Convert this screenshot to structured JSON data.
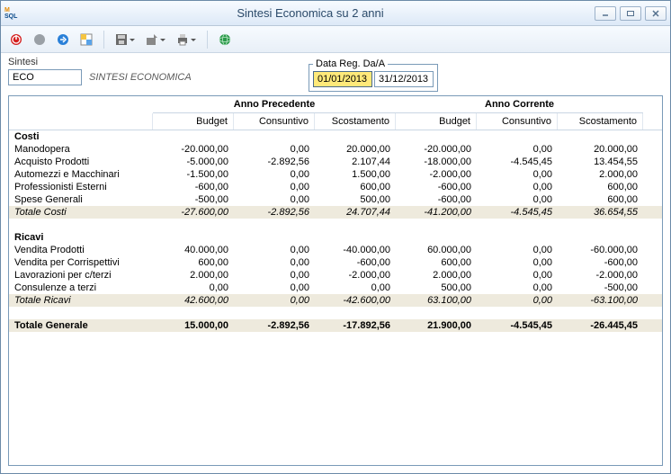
{
  "window": {
    "title": "Sintesi Economica su 2 anni"
  },
  "filter": {
    "sintesi_label": "Sintesi",
    "sintesi_value": "ECO",
    "sintesi_desc": "SINTESI ECONOMICA",
    "date_legend": "Data Reg. Da/A",
    "date_from": "01/01/2013",
    "date_to": "31/12/2013"
  },
  "headers": {
    "group_prev": "Anno Precedente",
    "group_curr": "Anno Corrente",
    "budget": "Budget",
    "consuntivo": "Consuntivo",
    "scostamento": "Scostamento"
  },
  "sections": [
    {
      "title": "Costi",
      "rows": [
        {
          "label": "Manodopera",
          "pb": "-20.000,00",
          "pc": "0,00",
          "ps": "20.000,00",
          "cb": "-20.000,00",
          "cc": "0,00",
          "cs": "20.000,00"
        },
        {
          "label": "Acquisto Prodotti",
          "pb": "-5.000,00",
          "pc": "-2.892,56",
          "ps": "2.107,44",
          "cb": "-18.000,00",
          "cc": "-4.545,45",
          "cs": "13.454,55"
        },
        {
          "label": "Automezzi e Macchinari",
          "pb": "-1.500,00",
          "pc": "0,00",
          "ps": "1.500,00",
          "cb": "-2.000,00",
          "cc": "0,00",
          "cs": "2.000,00"
        },
        {
          "label": "Professionisti Esterni",
          "pb": "-600,00",
          "pc": "0,00",
          "ps": "600,00",
          "cb": "-600,00",
          "cc": "0,00",
          "cs": "600,00"
        },
        {
          "label": "Spese Generali",
          "pb": "-500,00",
          "pc": "0,00",
          "ps": "500,00",
          "cb": "-600,00",
          "cc": "0,00",
          "cs": "600,00"
        }
      ],
      "total": {
        "label": "Totale Costi",
        "pb": "-27.600,00",
        "pc": "-2.892,56",
        "ps": "24.707,44",
        "cb": "-41.200,00",
        "cc": "-4.545,45",
        "cs": "36.654,55"
      }
    },
    {
      "title": "Ricavi",
      "rows": [
        {
          "label": "Vendita Prodotti",
          "pb": "40.000,00",
          "pc": "0,00",
          "ps": "-40.000,00",
          "cb": "60.000,00",
          "cc": "0,00",
          "cs": "-60.000,00"
        },
        {
          "label": "Vendita per Corrispettivi",
          "pb": "600,00",
          "pc": "0,00",
          "ps": "-600,00",
          "cb": "600,00",
          "cc": "0,00",
          "cs": "-600,00"
        },
        {
          "label": "Lavorazioni per c/terzi",
          "pb": "2.000,00",
          "pc": "0,00",
          "ps": "-2.000,00",
          "cb": "2.000,00",
          "cc": "0,00",
          "cs": "-2.000,00"
        },
        {
          "label": "Consulenze a terzi",
          "pb": "0,00",
          "pc": "0,00",
          "ps": "0,00",
          "cb": "500,00",
          "cc": "0,00",
          "cs": "-500,00"
        }
      ],
      "total": {
        "label": "Totale Ricavi",
        "pb": "42.600,00",
        "pc": "0,00",
        "ps": "-42.600,00",
        "cb": "63.100,00",
        "cc": "0,00",
        "cs": "-63.100,00"
      }
    }
  ],
  "grand": {
    "label": "Totale Generale",
    "pb": "15.000,00",
    "pc": "-2.892,56",
    "ps": "-17.892,56",
    "cb": "21.900,00",
    "cc": "-4.545,45",
    "cs": "-26.445,45"
  }
}
